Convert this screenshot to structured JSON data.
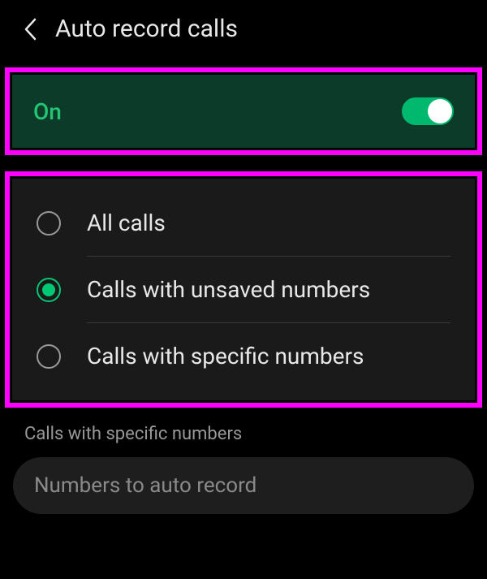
{
  "header": {
    "title": "Auto record calls"
  },
  "toggle": {
    "label": "On",
    "state": true
  },
  "options": [
    {
      "label": "All calls",
      "selected": false
    },
    {
      "label": "Calls with unsaved numbers",
      "selected": true
    },
    {
      "label": "Calls with specific numbers",
      "selected": false
    }
  ],
  "specific": {
    "section_label": "Calls with specific numbers",
    "placeholder": "Numbers to auto record"
  }
}
